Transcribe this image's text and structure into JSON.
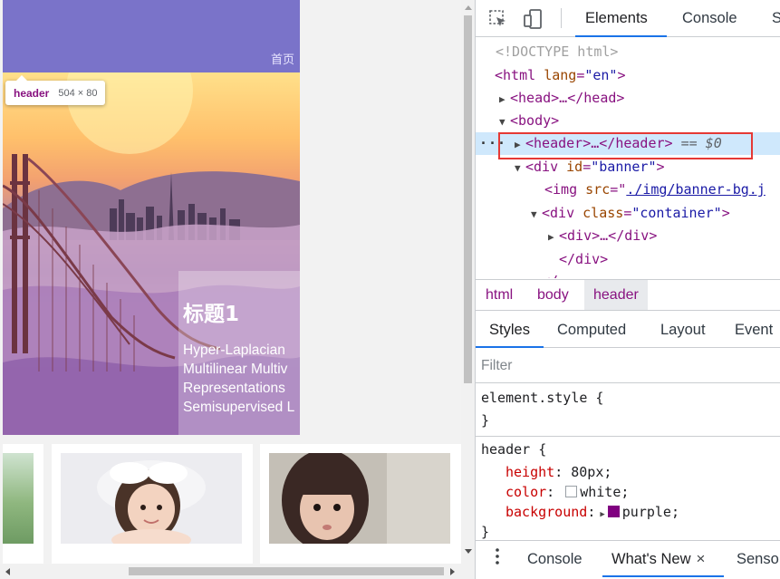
{
  "page": {
    "nav_home": "首页",
    "tooltip": {
      "tag": "header",
      "size": "504 × 80"
    },
    "banner": {
      "caption_title": "标题1",
      "caption_lines": [
        "Hyper-Laplacian",
        "Multilinear Multiv",
        "Representations",
        "Semisupervised L"
      ]
    }
  },
  "devtools": {
    "tabs": {
      "elements": "Elements",
      "console": "Console",
      "sources": "S"
    },
    "dom": {
      "doctype": "<!DOCTYPE html>",
      "html_open": "<html",
      "lang_attr": "lang",
      "lang_val": "\"en\"",
      "head": "<head>…</head>",
      "body_open": "<body>",
      "header_line": "<header>…</header>",
      "selected_marker": "== $0",
      "div_open": "<div",
      "id_attr": "id",
      "id_val": "\"banner\"",
      "img_open": "<img",
      "src_attr": "src",
      "src_val": "./img/banner-bg.j",
      "class_attr": "class",
      "class_val": "\"container\"",
      "div_collapsed": "<div>…</div>",
      "div_close": "</div>",
      "partial": "</"
    },
    "breadcrumbs": [
      "html",
      "body",
      "header"
    ],
    "subtabs": {
      "styles": "Styles",
      "computed": "Computed",
      "layout": "Layout",
      "events": "Event"
    },
    "filter_placeholder": "Filter",
    "styles": {
      "element_style_selector": "element.style {",
      "close_brace": "}",
      "header_selector": "header {",
      "props": [
        {
          "name": "height",
          "value": "80px"
        },
        {
          "name": "color",
          "value": "white"
        },
        {
          "name": "background",
          "value": "purple"
        }
      ],
      "swatch_colors": {
        "white": "#ffffff",
        "purple": "#800080"
      }
    },
    "drawer": {
      "console": "Console",
      "whats_new": "What's New",
      "close": "×",
      "sensors": "Senso"
    }
  },
  "colors": {
    "header_bg": "#7a73c9",
    "accent": "#1a73e8",
    "highlight_box": "#e53935",
    "tag": "#881280"
  }
}
